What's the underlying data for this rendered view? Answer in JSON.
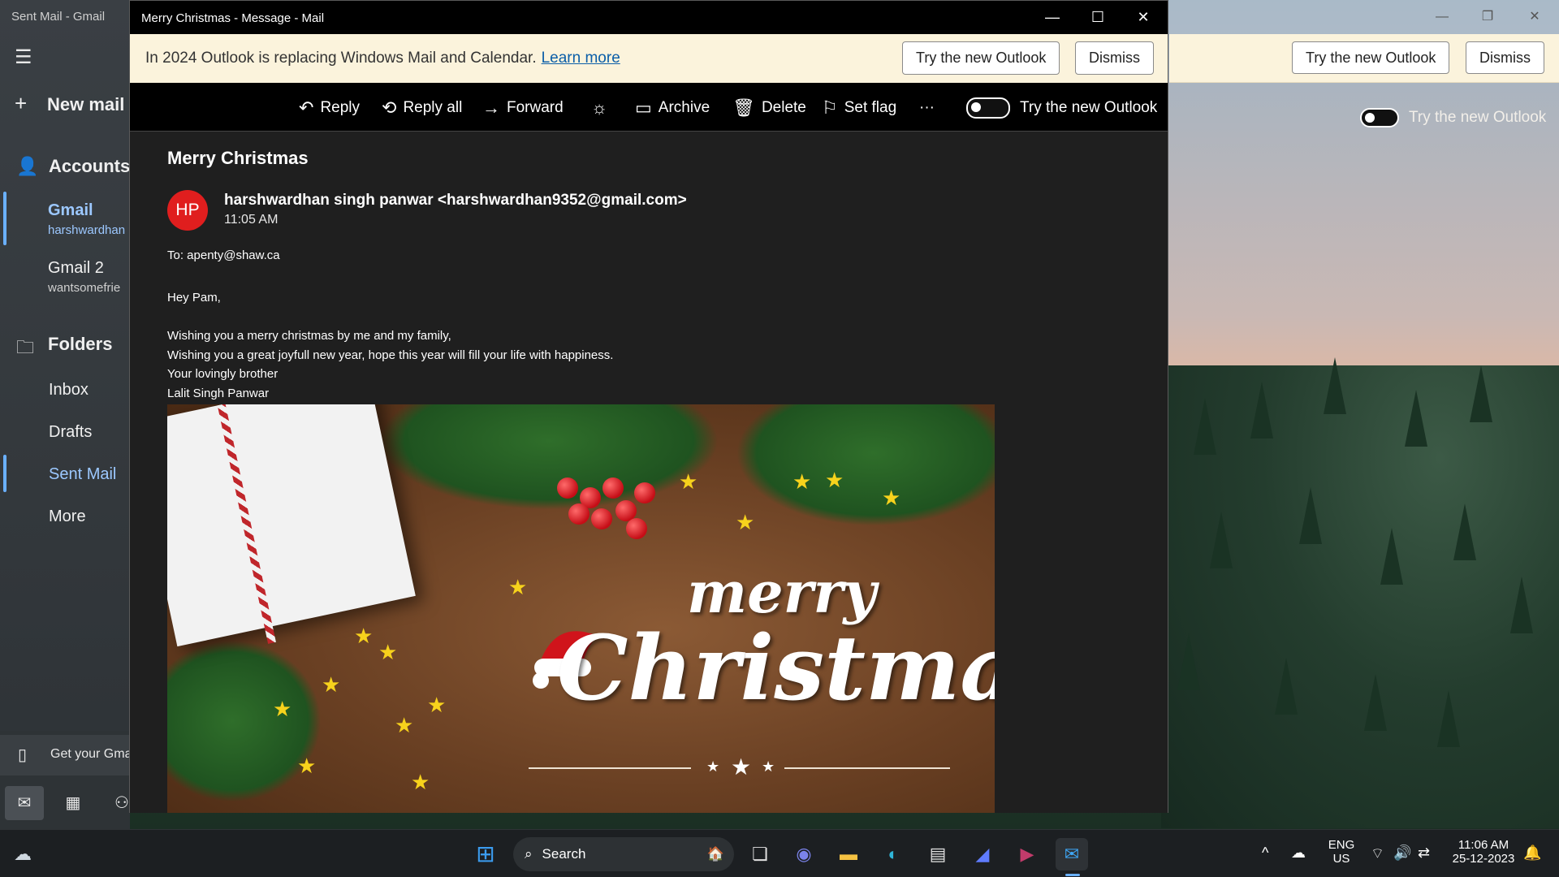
{
  "background_window": {
    "title": "Sent Mail - Gmail",
    "banner": {
      "try_button": "Try the new Outlook",
      "dismiss_button": "Dismiss"
    },
    "toggle_label": "Try the new Outlook",
    "sidebar": {
      "new_mail": "New mail",
      "accounts_header": "Accounts",
      "accounts": [
        {
          "name": "Gmail",
          "email": "harshwardhan"
        },
        {
          "name": "Gmail 2",
          "email": "wantsomefrie"
        }
      ],
      "folders_header": "Folders",
      "folders": [
        "Inbox",
        "Drafts",
        "Sent Mail",
        "More"
      ],
      "get_gmail": "Get your Gma"
    }
  },
  "message_window": {
    "title": "Merry Christmas - Message - Mail",
    "banner": {
      "text": "In 2024 Outlook is replacing Windows Mail and Calendar.",
      "link": "Learn more",
      "try_button": "Try the new Outlook",
      "dismiss_button": "Dismiss"
    },
    "toolbar": {
      "reply": "Reply",
      "reply_all": "Reply all",
      "forward": "Forward",
      "archive": "Archive",
      "delete": "Delete",
      "set_flag": "Set flag",
      "more": "···",
      "toggle_label": "Try the new Outlook"
    },
    "email": {
      "subject": "Merry Christmas",
      "avatar_initials": "HP",
      "avatar_color": "#e01e1e",
      "sender": "harshwardhan singh panwar <harshwardhan9352@gmail.com>",
      "time": "11:05 AM",
      "to": "To: apenty@shaw.ca",
      "greeting": "Hey Pam,",
      "lines": [
        "Wishing you a merry christmas by me and my family,",
        "Wishing you a great joyfull new year, hope this year will fill your life with happiness.",
        "Your lovingly brother",
        "Lalit Singh Panwar"
      ],
      "image": {
        "text_top": "merry",
        "text_bottom": "Christmas"
      }
    }
  },
  "taskbar": {
    "search_label": "Search",
    "language": "ENG",
    "region": "US",
    "time": "11:06 AM",
    "date": "25-12-2023"
  }
}
